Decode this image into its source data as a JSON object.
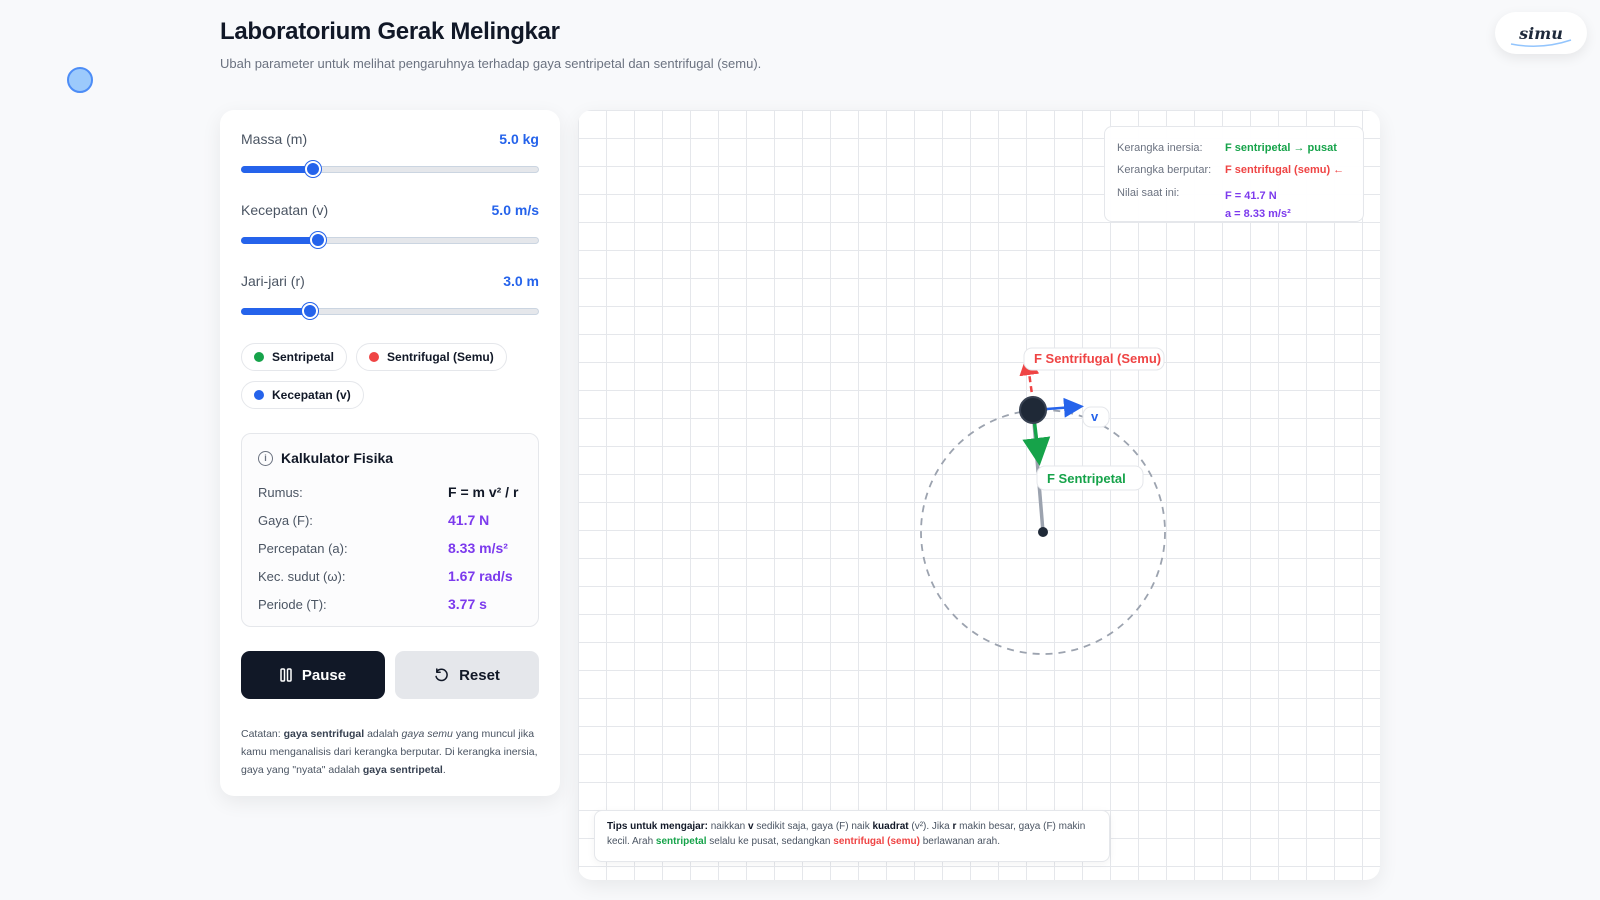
{
  "header": {
    "title": "Laboratorium Gerak Melingkar",
    "subtitle": "Ubah parameter untuk melihat pengaruhnya terhadap gaya sentripetal dan sentrifugal (semu)."
  },
  "logo": {
    "text": "simu"
  },
  "sliders": {
    "mass": {
      "label": "Massa (m)",
      "value": "5.0 kg",
      "fraction": 0.24
    },
    "speed": {
      "label": "Kecepatan (v)",
      "value": "5.0 m/s",
      "fraction": 0.26
    },
    "radius": {
      "label": "Jari-jari (r)",
      "value": "3.0 m",
      "fraction": 0.23
    }
  },
  "legend": {
    "centripetal": "Sentripetal",
    "centrifugal": "Sentrifugal (Semu)",
    "velocity": "Kecepatan (v)"
  },
  "colors": {
    "centripetal": "#16a34a",
    "centrifugal": "#ef4444",
    "velocity": "#2563eb",
    "accent": "#7c3aed"
  },
  "calculator": {
    "title": "Kalkulator Fisika",
    "formula_label": "Rumus:",
    "formula": "F = m v² / r",
    "force_label": "Gaya (F):",
    "force": "41.7 N",
    "accel_label": "Percepatan (a):",
    "accel": "8.33 m/s²",
    "omega_label": "Kec. sudut (ω):",
    "omega": "1.67 rad/s",
    "period_label": "Periode (T):",
    "period": "3.77 s"
  },
  "buttons": {
    "pause": "Pause",
    "reset": "Reset"
  },
  "note": {
    "p1": "Catatan: ",
    "b1": "gaya sentrifugal",
    "p2": " adalah ",
    "i1": "gaya semu",
    "p3": " yang muncul jika kamu menganalisis dari kerangka berputar. Di kerangka inersia, gaya yang \"nyata\" adalah ",
    "b2": "gaya sentripetal",
    "p4": "."
  },
  "info_box": {
    "inertial_label": "Kerangka inersia:",
    "inertial_value": "F sentripetal → pusat",
    "rotating_label": "Kerangka berputar:",
    "rotating_value": "F sentrifugal (semu) ←",
    "current_label": "Nilai saat ini:",
    "current_force": "F = 41.7 N",
    "current_accel": "a = 8.33 m/s²"
  },
  "scene": {
    "centrifugal_label": "F Sentrifugal (Semu)",
    "centripetal_label": "F Sentripetal",
    "velocity_label": "v"
  },
  "tips": {
    "t1": "Tips untuk mengajar:",
    "t2": " naikkan ",
    "t3": "v",
    "t4": " sedikit saja, gaya (F) naik ",
    "t5": "kuadrat",
    "t6": " (v²). Jika ",
    "t7": "r",
    "t8": " makin besar, gaya (F) makin kecil. Arah ",
    "t9": "sentripetal",
    "t10": " selalu ke pusat, sedangkan ",
    "t11": "sentrifugal (semu)",
    "t12": " berlawanan arah."
  }
}
